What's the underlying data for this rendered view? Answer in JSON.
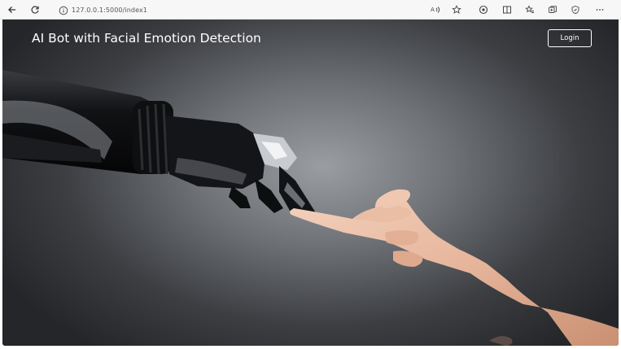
{
  "browser": {
    "url": "127.0.0.1:5000/index1",
    "icons": [
      "back-arrow-icon",
      "refresh-icon",
      "info-icon",
      "read-aloud-icon",
      "favorite-star-icon",
      "extension-icon",
      "split-screen-icon",
      "favorites-icon",
      "collections-icon",
      "browser-essentials-icon",
      "more-icon"
    ]
  },
  "page": {
    "title": "AI Bot with Facial Emotion Detection",
    "login_label": "Login"
  },
  "colors": {
    "background_dark": "#242629",
    "background_light": "#9a9da2",
    "text": "#ffffff"
  }
}
